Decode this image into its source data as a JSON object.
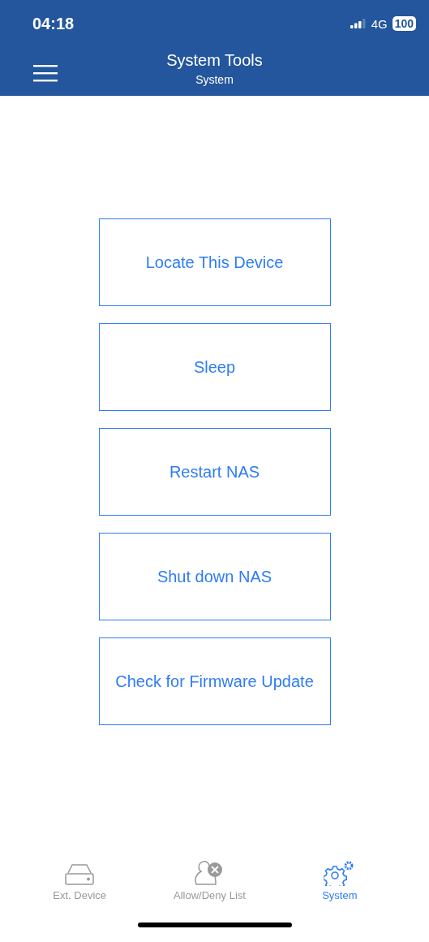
{
  "status_bar": {
    "time": "04:18",
    "network": "4G",
    "battery": "100"
  },
  "nav": {
    "title": "System Tools",
    "subtitle": "System"
  },
  "actions": [
    "Locate This Device",
    "Sleep",
    "Restart NAS",
    "Shut down NAS",
    "Check for Firmware Update"
  ],
  "tabs": [
    {
      "kind": "drive",
      "label": "Ext. Device",
      "selected": false
    },
    {
      "kind": "user-block",
      "label": "Allow/Deny List",
      "selected": false
    },
    {
      "kind": "gears",
      "label": "System",
      "selected": true
    }
  ]
}
